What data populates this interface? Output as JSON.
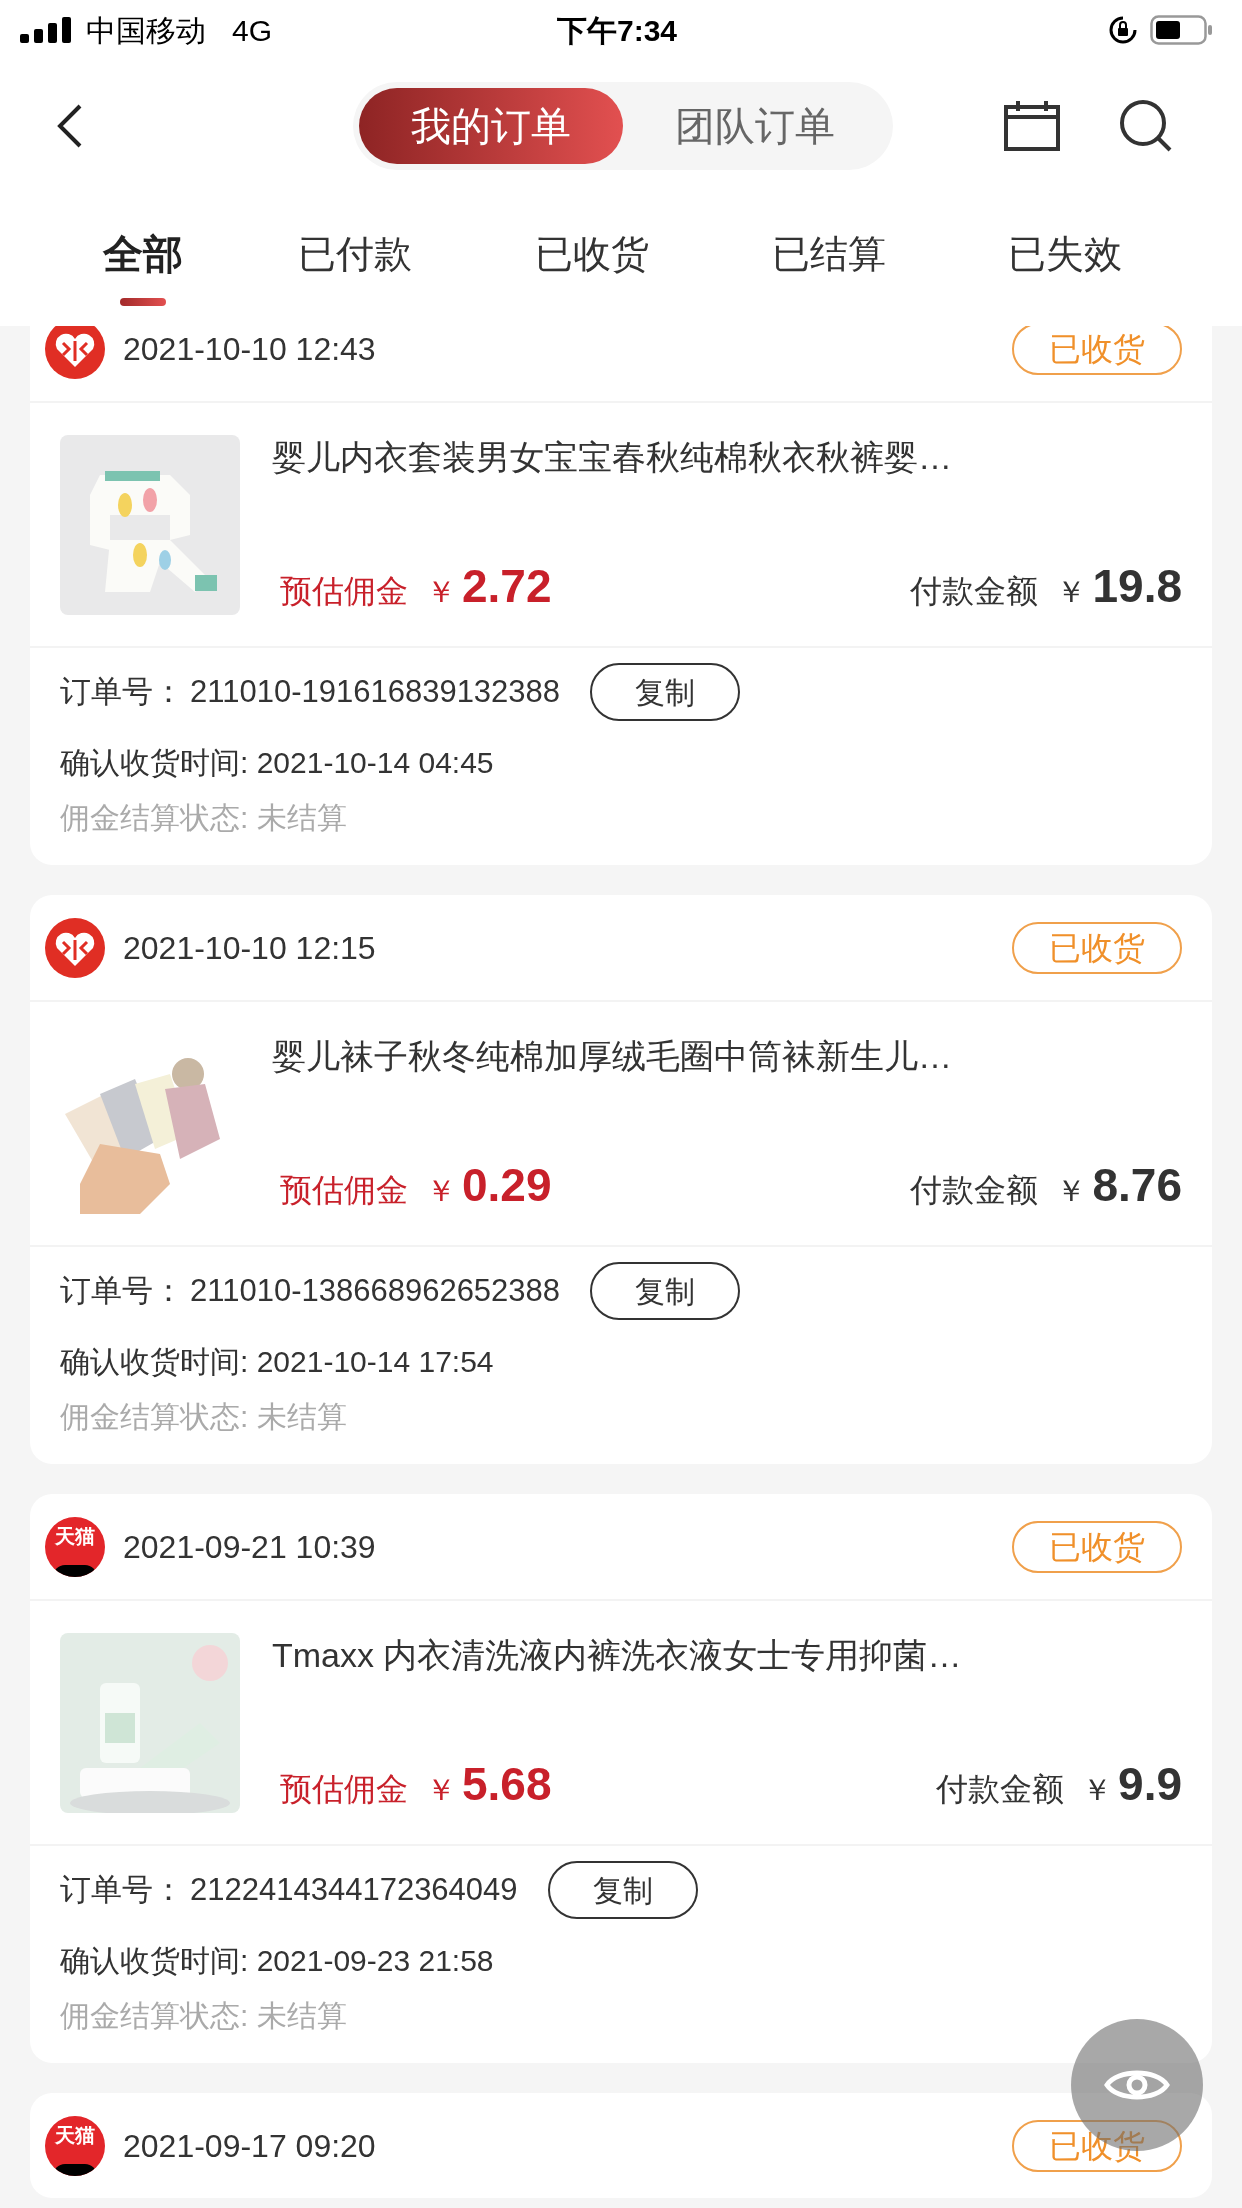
{
  "status_bar": {
    "carrier": "中国移动",
    "network": "4G",
    "time": "下午7:34"
  },
  "nav": {
    "segments": [
      {
        "label": "我的订单",
        "selected": true
      },
      {
        "label": "团队订单",
        "selected": false
      }
    ]
  },
  "tabs": [
    {
      "label": "全部",
      "selected": true
    },
    {
      "label": "已付款",
      "selected": false
    },
    {
      "label": "已收货",
      "selected": false
    },
    {
      "label": "已结算",
      "selected": false
    },
    {
      "label": "已失效",
      "selected": false
    }
  ],
  "orders": [
    {
      "shop": {
        "kind": "pinduoduo"
      },
      "time": "2021-10-10 12:43",
      "status": "已收货",
      "product": {
        "kind": "picture",
        "title": "婴儿内衣套装男女宝宝春秋纯棉秋衣秋裤婴…"
      },
      "commission_label": "预估佣金",
      "commission_currency": "￥",
      "commission": "2.72",
      "paid_label": "付款金额",
      "paid_currency": "￥",
      "paid": "19.8",
      "order_no_label": "订单号：",
      "order_no": "211010-191616839132388",
      "copy": "复制",
      "confirm": "确认收货时间: 2021-10-14 04:45",
      "settlement": "佣金结算状态: 未结算"
    },
    {
      "shop": {
        "kind": "pinduoduo"
      },
      "time": "2021-10-10 12:15",
      "status": "已收货",
      "product": {
        "kind": "picture",
        "title": "婴儿袜子秋冬纯棉加厚绒毛圈中筒袜新生儿…"
      },
      "commission_label": "预估佣金",
      "commission_currency": "￥",
      "commission": "0.29",
      "paid_label": "付款金额",
      "paid_currency": "￥",
      "paid": "8.76",
      "order_no_label": "订单号：",
      "order_no": "211010-138668962652388",
      "copy": "复制",
      "confirm": "确认收货时间: 2021-10-14 17:54",
      "settlement": "佣金结算状态: 未结算"
    },
    {
      "shop": {
        "kind": "tmall",
        "text": "天猫"
      },
      "time": "2021-09-21 10:39",
      "status": "已收货",
      "product": {
        "kind": "picture",
        "title": "Tmaxx 内衣清洗液内裤洗衣液女士专用抑菌…"
      },
      "commission_label": "预估佣金",
      "commission_currency": "￥",
      "commission": "5.68",
      "paid_label": "付款金额",
      "paid_currency": "￥",
      "paid": "9.9",
      "order_no_label": "订单号：",
      "order_no": "2122414344172364049",
      "copy": "复制",
      "confirm": "确认收货时间: 2021-09-23 21:58",
      "settlement": "佣金结算状态: 未结算"
    },
    {
      "shop": {
        "kind": "tmall",
        "text": "天猫"
      },
      "time": "2021-09-17 09:20",
      "status": "已收货"
    }
  ]
}
